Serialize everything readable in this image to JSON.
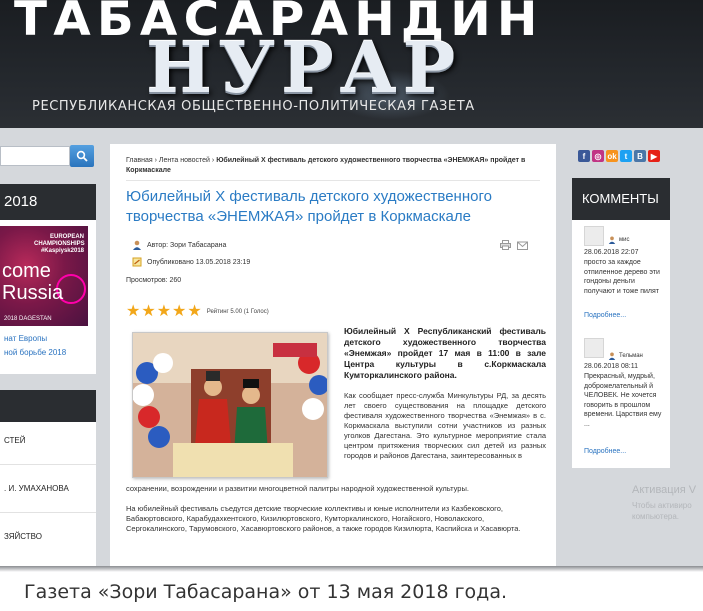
{
  "header": {
    "top_text": "ТАБАСАРАНДИН",
    "main_text": "НУРАР",
    "subtitle": "РЕСПУБЛИКАНСКАЯ ОБЩЕСТВЕННО-ПОЛИТИЧЕСКАЯ ГАЗЕТА"
  },
  "left_sidebar": {
    "card1_title": "2018",
    "banner": {
      "top": "EUROPEAN CHAMPIONSHIPS #Kaspiysk2018",
      "big": "come Russia",
      "foot": "2018 DAGESTAN"
    },
    "links": [
      "нат Европы",
      "ной борьбе 2018"
    ],
    "menu": [
      "СТЕЙ",
      ". И. УМАХАНОВА",
      "ЗЯЙСТВО"
    ]
  },
  "article": {
    "breadcrumb": {
      "home": "Главная",
      "sep": "›",
      "feed": "Лента новостей",
      "current": "Юбилейный X фестиваль детского художественного творчества «ЭНЕМЖАЯ» пройдет в Коркмаскале"
    },
    "title": "Юбилейный X фестиваль детского художественного творчества «ЭНЕМЖАЯ» пройдет в Коркмаскале",
    "author": "Автор: Зори Табасарана",
    "published": "Опубликовано 13.05.2018 23:19",
    "views": "Просмотров: 260",
    "rating_text": "Рейтинг 5.00 (1 Голос)",
    "rating_value": 5,
    "lead": "Юбилейный X Республиканский фестиваль детского художественного творчества «Энемжая» пройдет 17 мая в 11:00 в зале Центра культуры в с.Коркмаскала Кумторкалинского района.",
    "body1": "Как сообщает пресс-служба Минкультуры РД, за десять лет своего существования на площадке детского фестиваля художественного творчества «Энемжая» в с. Коркмаскала выступили сотни участников из разных уголков Дагестана. Это культурное мероприятие стала центром притяжения творческих сил детей из разных городов и районов Дагестана, заинтересованных в",
    "body2": "сохранении, возрождении и развитии многоцветной палитры народной художественной культуры.",
    "body3": "На юбилейный фестиваль съедутся детские творческие коллективы и юные исполнители из Казбековского, Бабаюртовского, Карабудахкентского, Кизилюртовского, Кумторкалинского, Ногайского, Новолакского, Сергокалинского, Тарумовского, Хасавюртовского районов, а также городов Кизилюрта, Каспийска и Хасавюрта."
  },
  "social": [
    "f",
    "◎",
    "ok",
    "t",
    "В",
    "▶"
  ],
  "comments": {
    "title": "КОММЕНТЫ",
    "items": [
      {
        "user": "мис",
        "date": "28.06.2018 22:07",
        "text": "просто за каждое отпиленное дерево эти гондоны деньги получают и тоже пилят",
        "more": "Подробнее..."
      },
      {
        "user": "Тельман",
        "date": "28.06.2018 08:11",
        "text": "Прекрасный, мудрый, доброжелательный й ЧЕЛОВЕК. Не хочется говорить в прошлом времени. Царствия ему ...",
        "more": "Подробнее..."
      }
    ]
  },
  "watermark": {
    "line1": "Активация V",
    "line2": "Чтобы активиро компьютера."
  },
  "caption": "Газета «Зори Табасарана» от 13 мая 2018 года."
}
